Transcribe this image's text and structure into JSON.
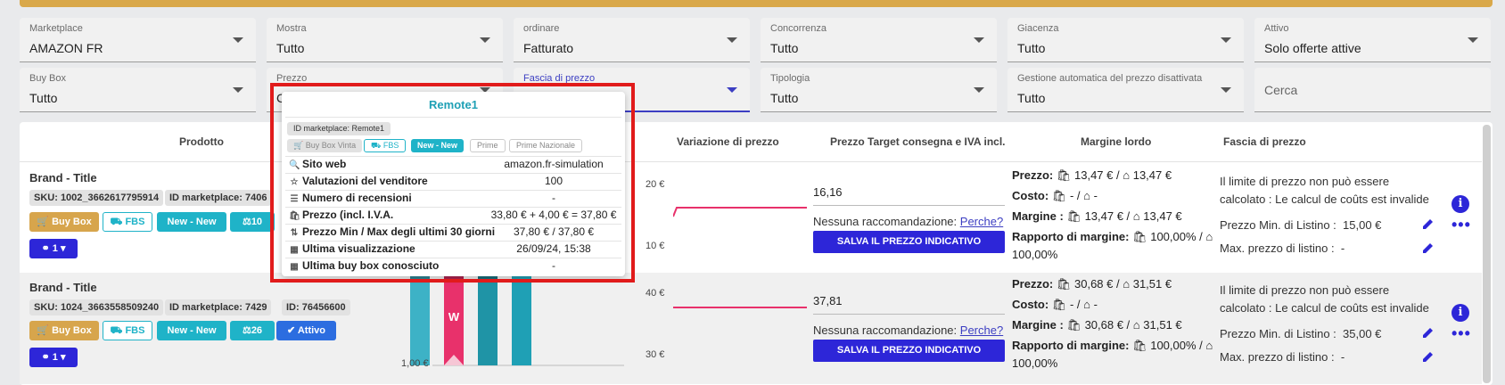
{
  "filters_row1": [
    {
      "label": "Marketplace",
      "value": "AMAZON FR"
    },
    {
      "label": "Mostra",
      "value": "Tutto"
    },
    {
      "label": "ordinare",
      "value": "Fatturato"
    },
    {
      "label": "Concorrenza",
      "value": "Tutto"
    },
    {
      "label": "Giacenza",
      "value": "Tutto"
    },
    {
      "label": "Attivo",
      "value": "Solo offerte attive"
    }
  ],
  "filters_row2": [
    {
      "label": "Buy Box",
      "value": "Tutto"
    },
    {
      "label": "Prezzo",
      "value": "C"
    },
    {
      "label": "Fascia di prezzo",
      "value": ""
    },
    {
      "label": "Tipologia",
      "value": "Tutto"
    },
    {
      "label": "Gestione automatica del prezzo disattivata",
      "value": "Tutto"
    }
  ],
  "search": {
    "placeholder": "Cerca"
  },
  "table": {
    "headers": {
      "prodotto": "Prodotto",
      "variazione": "Variazione di prezzo",
      "target": "Prezzo Target consegna e IVA incl.",
      "margine": "Margine lordo",
      "fascia": "Fascia di prezzo"
    }
  },
  "rows": [
    {
      "title": "Brand - Title",
      "sku": "SKU: 1002_3662617795914",
      "marketplace_id": "ID marketplace: 7406",
      "buttons": {
        "buybox": "Buy Box",
        "fbs": "FBS",
        "new": "New - New",
        "count": "10",
        "link": "1"
      },
      "axis": [
        "20 €",
        "10 €"
      ],
      "target_price": "16,16",
      "rec_text": "Nessuna raccomandazione:",
      "rec_link": "Perche?",
      "save_label": "SALVA IL PREZZO INDICATIVO",
      "margin": {
        "prezzo_label": "Prezzo:",
        "prezzo_val": "13,47 € /",
        "prezzo_val2": "13,47 €",
        "costo_label": "Costo:",
        "costo_val": "- /",
        "costo_val2": "-",
        "margine_label": "Margine :",
        "margine_val": "13,47 € /",
        "margine_val2": "13,47 €",
        "rapporto_label": "Rapporto di margine:",
        "rapporto_val": "100,00% /",
        "rapporto_val2": "100,00%"
      },
      "fascia": {
        "msg1": "Il limite di prezzo non può essere",
        "msg2": "calcolato : Le calcul de coûts est invalide",
        "min_label": "Prezzo Min. di Listino :",
        "min_val": "15,00 €",
        "max_label": "Max. prezzo di listino :",
        "max_val": "-"
      }
    },
    {
      "title": "Brand - Title",
      "sku": "SKU: 1024_3663558509240",
      "marketplace_id": "ID marketplace: 7429",
      "id": "ID: 76456600",
      "buttons": {
        "buybox": "Buy Box",
        "fbs": "FBS",
        "new": "New - New",
        "count": "26",
        "attivo": "Attivo",
        "link": "1"
      },
      "axis": [
        "40 €",
        "30 €"
      ],
      "chart_axis": "1,00 €",
      "target_price": "37,81",
      "rec_text": "Nessuna raccomandazione:",
      "rec_link": "Perche?",
      "save_label": "SALVA IL PREZZO INDICATIVO",
      "margin": {
        "prezzo_label": "Prezzo:",
        "prezzo_val": "30,68 € /",
        "prezzo_val2": "31,51 €",
        "costo_label": "Costo:",
        "costo_val": "- /",
        "costo_val2": "-",
        "margine_label": "Margine :",
        "margine_val": "30,68 € /",
        "margine_val2": "31,51 €",
        "rapporto_label": "Rapporto di margine:",
        "rapporto_val": "100,00% /",
        "rapporto_val2": "100,00%"
      },
      "fascia": {
        "msg1": "Il limite di prezzo non può essere",
        "msg2": "calcolato : Le calcul de coûts est invalide",
        "min_label": "Prezzo Min. di Listino :",
        "min_val": "35,00 €",
        "max_label": "Max. prezzo di listino :",
        "max_val": "-"
      }
    }
  ],
  "popup": {
    "title": "Remote1",
    "tag_marketplace": "ID marketplace: Remote1",
    "tags": [
      "Buy Box Vinta",
      "FBS",
      "New - New",
      "Prime",
      "Prime Nazionale"
    ],
    "rows": [
      {
        "label": "Sito web",
        "value": "amazon.fr-simulation",
        "icon": "search-icon"
      },
      {
        "label": "Valutazioni del venditore",
        "value": "100",
        "icon": "star-icon"
      },
      {
        "label": "Numero di recensioni",
        "value": "-",
        "icon": "list-icon"
      },
      {
        "label": "Prezzo (incl. I.V.A.",
        "value": "33,80 € + 4,00 € = 37,80 €",
        "icon": "bag-icon"
      },
      {
        "label": "Prezzo Min / Max degli ultimi 30 giorni",
        "value": "37,80 € / 37,80 €",
        "icon": "sort-icon"
      },
      {
        "label": "Ultima visualizzazione",
        "value": "26/09/24, 15:38",
        "icon": "calendar-icon"
      },
      {
        "label": "Ultima buy box conosciuto",
        "value": "-",
        "icon": "calendar-icon"
      }
    ]
  },
  "bar_chart": {
    "type": "bar",
    "bars": [
      {
        "value": 1.0,
        "color": "#3db2c6",
        "label": ""
      },
      {
        "value": 1.0,
        "color": "#e8316b",
        "label": "W"
      },
      {
        "value": 1.0,
        "color": "#1f94a6",
        "label": ""
      },
      {
        "value": 1.15,
        "color": "#1fa0b5",
        "label": ""
      }
    ]
  },
  "colors": {
    "accent": "#2d26d8",
    "teal": "#1fb3c8",
    "gold": "#d7a54c",
    "pink": "#e8316b",
    "red_highlight": "#e11b1b"
  }
}
